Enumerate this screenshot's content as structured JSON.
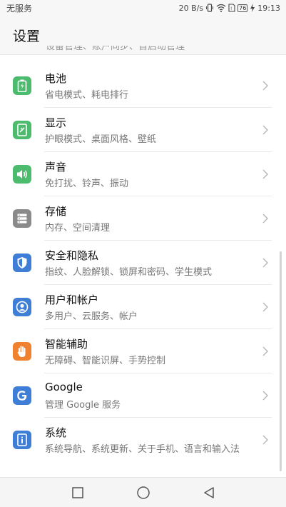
{
  "status_bar": {
    "carrier": "无服务",
    "network_speed": "20 B/s",
    "battery_level": "76",
    "time": "19:13"
  },
  "header": {
    "title": "设置"
  },
  "cutoff_text": "设备管理、账户同步、自启动管理",
  "items": [
    {
      "title": "电池",
      "subtitle": "省电模式、耗电排行",
      "icon": "battery-icon",
      "color": "#4cbb6e"
    },
    {
      "title": "显示",
      "subtitle": "护眼模式、桌面风格、壁纸",
      "icon": "display-icon",
      "color": "#4cbb6e"
    },
    {
      "title": "声音",
      "subtitle": "免打扰、铃声、振动",
      "icon": "speaker-icon",
      "color": "#4cbb6e"
    },
    {
      "title": "存储",
      "subtitle": "内存、空间清理",
      "icon": "storage-icon",
      "color": "#8a8a8a"
    },
    {
      "title": "安全和隐私",
      "subtitle": "指纹、人脸解锁、锁屏和密码、学生模式",
      "icon": "shield-icon",
      "color": "#3f7ed6"
    },
    {
      "title": "用户和帐户",
      "subtitle": "多用户、云服务、帐户",
      "icon": "user-icon",
      "color": "#3f7ed6"
    },
    {
      "title": "智能辅助",
      "subtitle": "无障碍、智能识屏、手势控制",
      "icon": "hand-icon",
      "color": "#f0822f"
    },
    {
      "title": "Google",
      "subtitle": "管理 Google 服务",
      "icon": "google-icon",
      "color": "#3f7ed6"
    },
    {
      "title": "系统",
      "subtitle": "系统导航、系统更新、关于手机、语言和输入法",
      "icon": "info-icon",
      "color": "#3f7ed6"
    }
  ]
}
